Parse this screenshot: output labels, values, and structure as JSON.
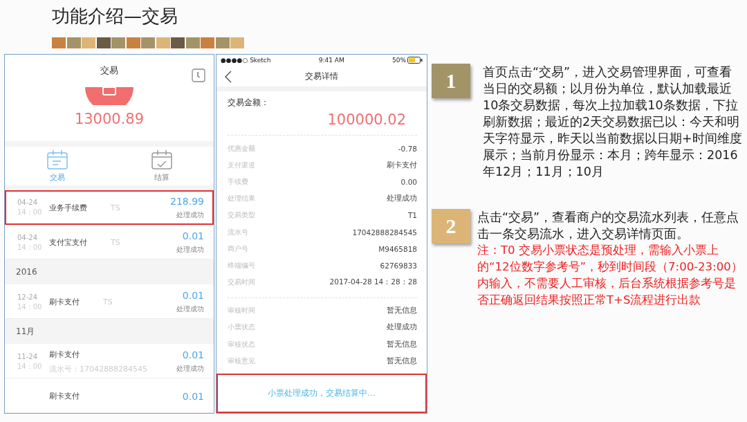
{
  "title": "功能介绍—交易",
  "palette": [
    {
      "color": "#c9813f"
    },
    {
      "color": "#a39467"
    },
    {
      "color": "#dcb576"
    },
    {
      "color": "#6b5a44"
    },
    {
      "color": "#a39467"
    },
    {
      "color": "#c9813f"
    },
    {
      "color": "#a39467"
    },
    {
      "color": "#dcb576"
    },
    {
      "color": "#6b5a44"
    },
    {
      "color": "#a39467"
    },
    {
      "color": "#c9813f"
    },
    {
      "color": "#a39467"
    },
    {
      "color": "#dcb576"
    }
  ],
  "list_screen": {
    "title": "交易",
    "amount": "13000.89",
    "tabs": [
      {
        "label": "交易",
        "selected": true
      },
      {
        "label": "结算",
        "selected": false
      }
    ],
    "items": [
      {
        "kind": "row",
        "date": "04-24",
        "time": "14：00",
        "name": "业务手续费",
        "tag": "TS",
        "amount": "218.99",
        "status": "处理成功",
        "highlighted": true
      },
      {
        "kind": "row",
        "date": "04-24",
        "time": "14：00",
        "name": "支付宝支付",
        "tag": "TS",
        "amount": "0.01",
        "status": "处理成功",
        "highlighted": false
      },
      {
        "kind": "section",
        "label": "2016"
      },
      {
        "kind": "row",
        "date": "12-24",
        "time": "14：00",
        "name": "刷卡支付",
        "tag": "TS",
        "amount": "0.01",
        "status": "处理成功",
        "highlighted": false
      },
      {
        "kind": "section",
        "label": "11月"
      },
      {
        "kind": "row",
        "date": "11-24",
        "time": "14：00",
        "name": "刷卡支付",
        "serial": "流水号：17042888284545",
        "amount": "0.01",
        "status": "处理成功",
        "highlighted": false
      },
      {
        "kind": "row",
        "name": "刷卡支付",
        "amount": "0.01",
        "highlighted": false
      }
    ]
  },
  "detail_screen": {
    "status_bar": {
      "carrier": "●●●●○ Sketch",
      "time": "9:41 AM",
      "battery": "50%"
    },
    "title": "交易详情",
    "amount_label": "交易金额：",
    "amount": "100000.02",
    "field_groups": [
      [
        {
          "label": "优惠金额",
          "value": "-0.78"
        },
        {
          "label": "支付渠道",
          "value": "刷卡支付"
        },
        {
          "label": "手续费",
          "value": "0.00"
        },
        {
          "label": "处理结果",
          "value": "处理成功"
        },
        {
          "label": "交易类型",
          "value": "T1"
        },
        {
          "label": "流水号",
          "value": "17042888284545"
        },
        {
          "label": "商户号",
          "value": "M9465818"
        },
        {
          "label": "终端编号",
          "value": "62769833"
        },
        {
          "label": "交易时间",
          "value": "2017-04-28 14：28：28"
        }
      ],
      [
        {
          "label": "审核时间",
          "value": "暂无信息"
        },
        {
          "label": "小票状态",
          "value": "处理成功"
        },
        {
          "label": "审核状态",
          "value": "暂无信息"
        },
        {
          "label": "审核意见",
          "value": "暂无信息"
        }
      ]
    ],
    "footer": {
      "text": "小票处理成功，交易结算中...",
      "highlighted": true
    }
  },
  "notes": [
    {
      "number": "1",
      "color": "#a39467",
      "paragraphs": [
        {
          "kind": "normal",
          "text": "首页点击“交易”，进入交易管理界面，可查看当日的交易额；以月份为单位，默认加载最近10条交易数据，每次上拉加载10条数据，下拉刷新数据；最近的2天交易数据已以：今天和明天字符显示，昨天以当前数据以日期+时间维度展示；当前月份显示：本月；跨年显示：2016年12月；11月；10月"
        }
      ]
    },
    {
      "number": "2",
      "color": "#dcb576",
      "paragraphs": [
        {
          "kind": "normal",
          "text": "点击“交易”，查看商户的交易流水列表，任意点击一条交易流水，进入交易详情页面。"
        },
        {
          "kind": "note",
          "text": "注：T0 交易小票状态是预处理，需输入小票上的“12位数字参考号”，秒到时间段（7:00-23:00）内输入，不需要人工审核，后台系统根据参考号是否正确返回结果按照正常T+S流程进行出款"
        }
      ]
    }
  ]
}
